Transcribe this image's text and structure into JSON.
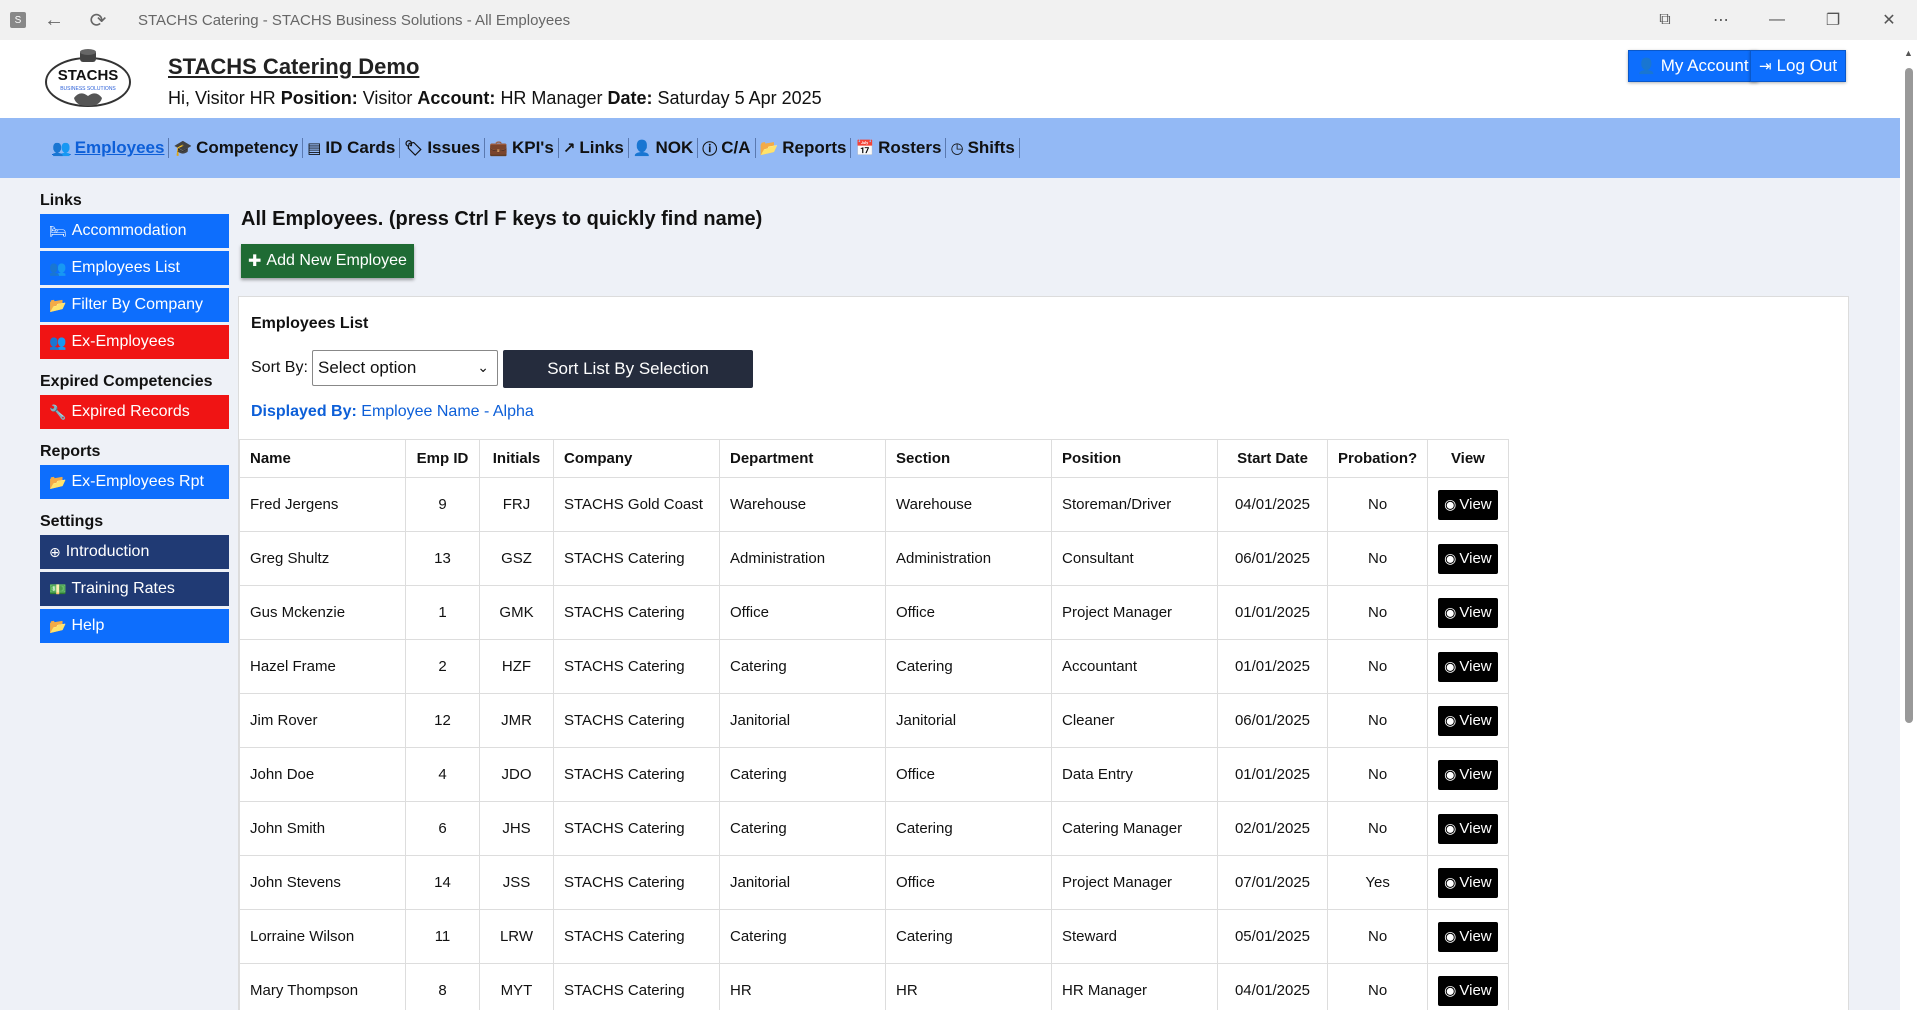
{
  "window": {
    "title": "STACHS Catering - STACHS Business Solutions - All Employees",
    "app_icon_letter": "S"
  },
  "header": {
    "logo_text": "STACHS",
    "logo_subtext": "BUSINESS SOLUTIONS",
    "site_title": "STACHS Catering Demo",
    "greeting_prefix": "Hi, Visitor HR",
    "position_label": "Position:",
    "position_value": "Visitor",
    "account_label": "Account:",
    "account_value": "HR Manager",
    "date_label": "Date:",
    "date_value": "Saturday 5 Apr 2025",
    "my_account": "My Account",
    "log_out": "Log Out"
  },
  "nav": [
    {
      "label": "Employees",
      "icon": "users-icon",
      "glyph": "👥"
    },
    {
      "label": "Competency",
      "icon": "graduation-cap-icon",
      "glyph": "🎓"
    },
    {
      "label": "ID Cards",
      "icon": "id-card-icon",
      "glyph": "▤"
    },
    {
      "label": "Issues",
      "icon": "tags-icon",
      "glyph": "🏷"
    },
    {
      "label": "KPI's",
      "icon": "briefcase-icon",
      "glyph": "💼"
    },
    {
      "label": "Links",
      "icon": "external-link-icon",
      "glyph": "↗"
    },
    {
      "label": "NOK",
      "icon": "user-icon",
      "glyph": "👤"
    },
    {
      "label": "C/A",
      "icon": "info-circle-icon",
      "glyph": "ⓘ"
    },
    {
      "label": "Reports",
      "icon": "folder-open-icon",
      "glyph": "📂"
    },
    {
      "label": "Rosters",
      "icon": "calendar-icon",
      "glyph": "📅"
    },
    {
      "label": "Shifts",
      "icon": "clock-icon",
      "glyph": "◷"
    }
  ],
  "sidebar": {
    "links_heading": "Links",
    "links": [
      {
        "label": "Accommodation",
        "glyph": "🛏"
      },
      {
        "label": "Employees List",
        "glyph": "👥"
      },
      {
        "label": "Filter By Company",
        "glyph": "📂"
      },
      {
        "label": "Ex-Employees",
        "glyph": "👥"
      }
    ],
    "expired_heading": "Expired Competencies",
    "expired_records": {
      "label": "Expired Records",
      "glyph": "🔧"
    },
    "reports_heading": "Reports",
    "ex_employees_rpt": {
      "label": "Ex-Employees Rpt",
      "glyph": "📂"
    },
    "settings_heading": "Settings",
    "settings": [
      {
        "label": "Introduction",
        "glyph": "⊕"
      },
      {
        "label": "Training Rates",
        "glyph": "💵"
      },
      {
        "label": "Help",
        "glyph": "📂"
      }
    ]
  },
  "main": {
    "title": "All Employees. (press Ctrl F keys to quickly find name)",
    "add_button": "Add New Employee",
    "panel_title": "Employees List",
    "sort_label": "Sort By:",
    "sort_selected": "Select option",
    "sort_button": "Sort List By Selection",
    "displayed_label": "Displayed By:",
    "displayed_value": "Employee Name - Alpha",
    "columns": [
      "Name",
      "Emp ID",
      "Initials",
      "Company",
      "Department",
      "Section",
      "Position",
      "Start Date",
      "Probation?",
      "View"
    ],
    "view_label": "View",
    "rows": [
      [
        "Fred Jergens",
        "9",
        "FRJ",
        "STACHS Gold Coast",
        "Warehouse",
        "Warehouse",
        "Storeman/Driver",
        "04/01/2025",
        "No"
      ],
      [
        "Greg Shultz",
        "13",
        "GSZ",
        "STACHS Catering",
        "Administration",
        "Administration",
        "Consultant",
        "06/01/2025",
        "No"
      ],
      [
        "Gus Mckenzie",
        "1",
        "GMK",
        "STACHS Catering",
        "Office",
        "Office",
        "Project Manager",
        "01/01/2025",
        "No"
      ],
      [
        "Hazel Frame",
        "2",
        "HZF",
        "STACHS Catering",
        "Catering",
        "Catering",
        "Accountant",
        "01/01/2025",
        "No"
      ],
      [
        "Jim Rover",
        "12",
        "JMR",
        "STACHS Catering",
        "Janitorial",
        "Janitorial",
        "Cleaner",
        "06/01/2025",
        "No"
      ],
      [
        "John Doe",
        "4",
        "JDO",
        "STACHS Catering",
        "Catering",
        "Office",
        "Data Entry",
        "01/01/2025",
        "No"
      ],
      [
        "John Smith",
        "6",
        "JHS",
        "STACHS Catering",
        "Catering",
        "Catering",
        "Catering Manager",
        "02/01/2025",
        "No"
      ],
      [
        "John Stevens",
        "14",
        "JSS",
        "STACHS Catering",
        "Janitorial",
        "Office",
        "Project Manager",
        "07/01/2025",
        "Yes"
      ],
      [
        "Lorraine Wilson",
        "11",
        "LRW",
        "STACHS Catering",
        "Catering",
        "Catering",
        "Steward",
        "05/01/2025",
        "No"
      ],
      [
        "Mary Thompson",
        "8",
        "MYT",
        "STACHS Catering",
        "HR",
        "HR",
        "HR Manager",
        "04/01/2025",
        "No"
      ]
    ]
  }
}
